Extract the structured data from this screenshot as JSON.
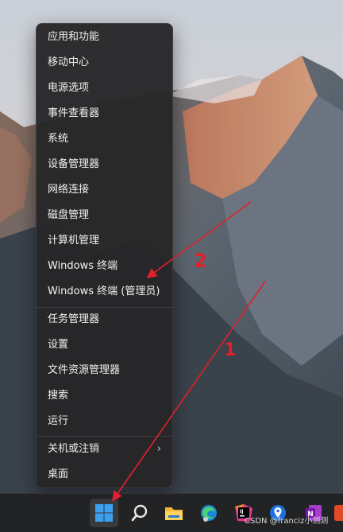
{
  "context_menu": {
    "items": [
      {
        "label": "应用和功能"
      },
      {
        "label": "移动中心"
      },
      {
        "label": "电源选项"
      },
      {
        "label": "事件查看器"
      },
      {
        "label": "系统"
      },
      {
        "label": "设备管理器"
      },
      {
        "label": "网络连接"
      },
      {
        "label": "磁盘管理"
      },
      {
        "label": "计算机管理"
      },
      {
        "label": "Windows 终端"
      },
      {
        "label": "Windows 终端 (管理员)"
      },
      {
        "label": "任务管理器"
      },
      {
        "label": "设置"
      },
      {
        "label": "文件资源管理器"
      },
      {
        "label": "搜索"
      },
      {
        "label": "运行"
      },
      {
        "label": "关机或注销",
        "has_submenu": true
      },
      {
        "label": "桌面"
      }
    ]
  },
  "annotations": {
    "label_1": "1",
    "label_2": "2",
    "color": "#e0202a"
  },
  "taskbar": {
    "apps": [
      {
        "name": "start-icon",
        "active": true
      },
      {
        "name": "search-icon"
      },
      {
        "name": "file-explorer-icon"
      },
      {
        "name": "edge-icon"
      },
      {
        "name": "intellij-icon"
      },
      {
        "name": "maps-icon"
      },
      {
        "name": "onenote-icon"
      }
    ]
  },
  "watermark": "CSDN @franciz小测测"
}
